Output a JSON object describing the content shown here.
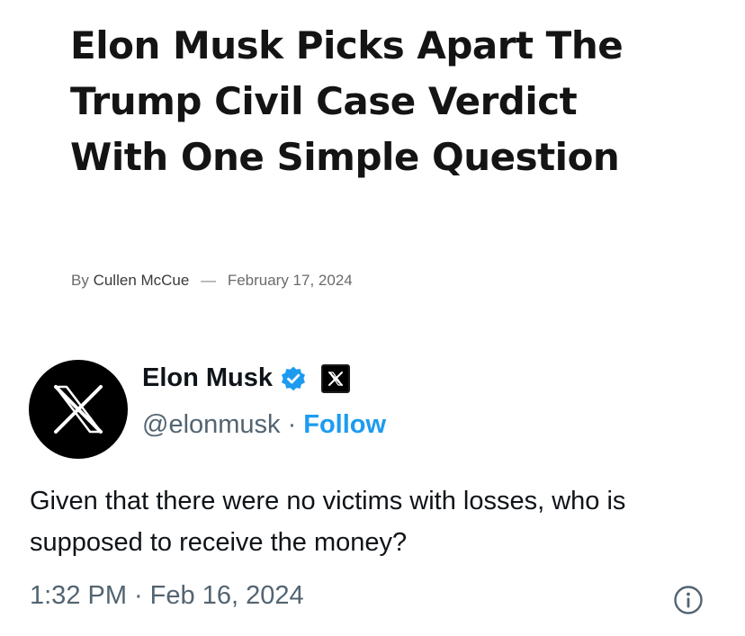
{
  "article": {
    "headline": "Elon Musk Picks Apart The Trump Civil Case Verdict With One Simple Question",
    "byline_prefix": "By",
    "author": "Cullen McCue",
    "dash": "—",
    "date": "February 17, 2024"
  },
  "tweet": {
    "display_name": "Elon Musk",
    "handle": "@elonmusk",
    "separator": "·",
    "follow_label": "Follow",
    "text": "Given that there were no victims with losses, who is supposed to receive the money?",
    "time": "1:32 PM",
    "date": "Feb 16, 2024",
    "icons": {
      "avatar": "x-logo-avatar",
      "verified": "verified-badge-icon",
      "badge": "x-logo-icon",
      "info": "info-icon"
    },
    "colors": {
      "link": "#1d9bf0",
      "verified": "#1d9bf0",
      "secondary_text": "#536471"
    }
  }
}
